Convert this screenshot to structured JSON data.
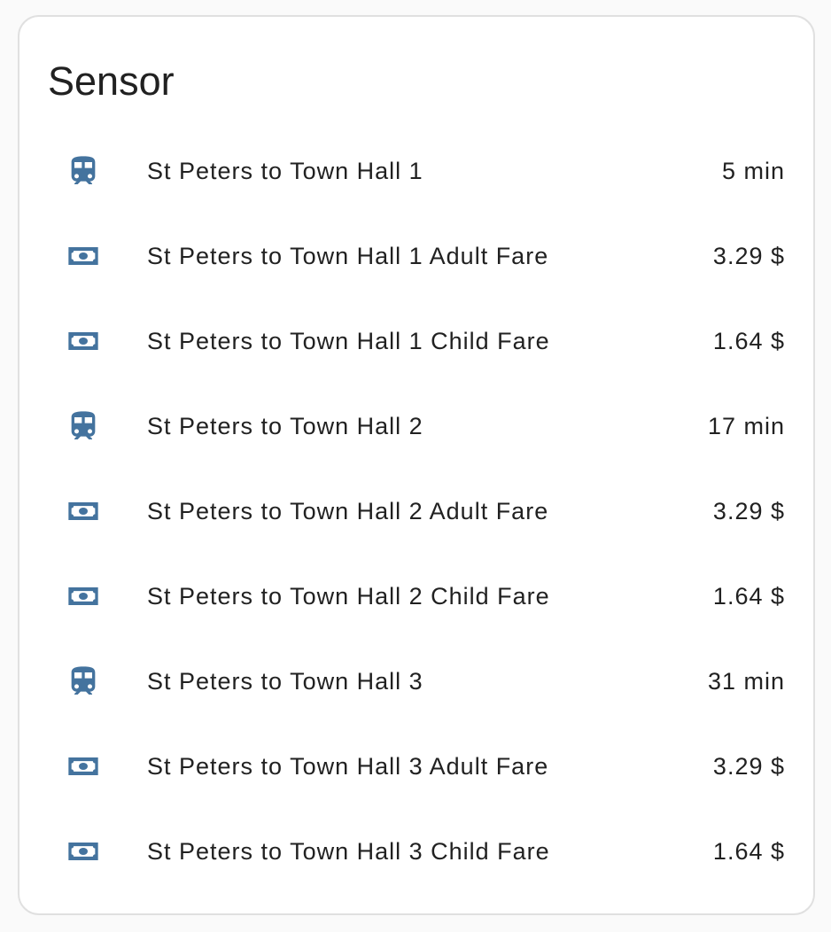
{
  "card": {
    "title": "Sensor"
  },
  "colors": {
    "icon": "#44739e",
    "text": "#212121",
    "card_border": "#e0e0e0",
    "background": "#fafafa"
  },
  "entities": [
    {
      "icon": "train-icon",
      "name": "St Peters to Town Hall 1",
      "state": "5 min"
    },
    {
      "icon": "cash-icon",
      "name": "St Peters to Town Hall 1 Adult Fare",
      "state": "3.29 $"
    },
    {
      "icon": "cash-icon",
      "name": "St Peters to Town Hall 1 Child Fare",
      "state": "1.64 $"
    },
    {
      "icon": "train-icon",
      "name": "St Peters to Town Hall 2",
      "state": "17 min"
    },
    {
      "icon": "cash-icon",
      "name": "St Peters to Town Hall 2 Adult Fare",
      "state": "3.29 $"
    },
    {
      "icon": "cash-icon",
      "name": "St Peters to Town Hall 2 Child Fare",
      "state": "1.64 $"
    },
    {
      "icon": "train-icon",
      "name": "St Peters to Town Hall 3",
      "state": "31 min"
    },
    {
      "icon": "cash-icon",
      "name": "St Peters to Town Hall 3 Adult Fare",
      "state": "3.29 $"
    },
    {
      "icon": "cash-icon",
      "name": "St Peters to Town Hall 3 Child Fare",
      "state": "1.64 $"
    }
  ]
}
